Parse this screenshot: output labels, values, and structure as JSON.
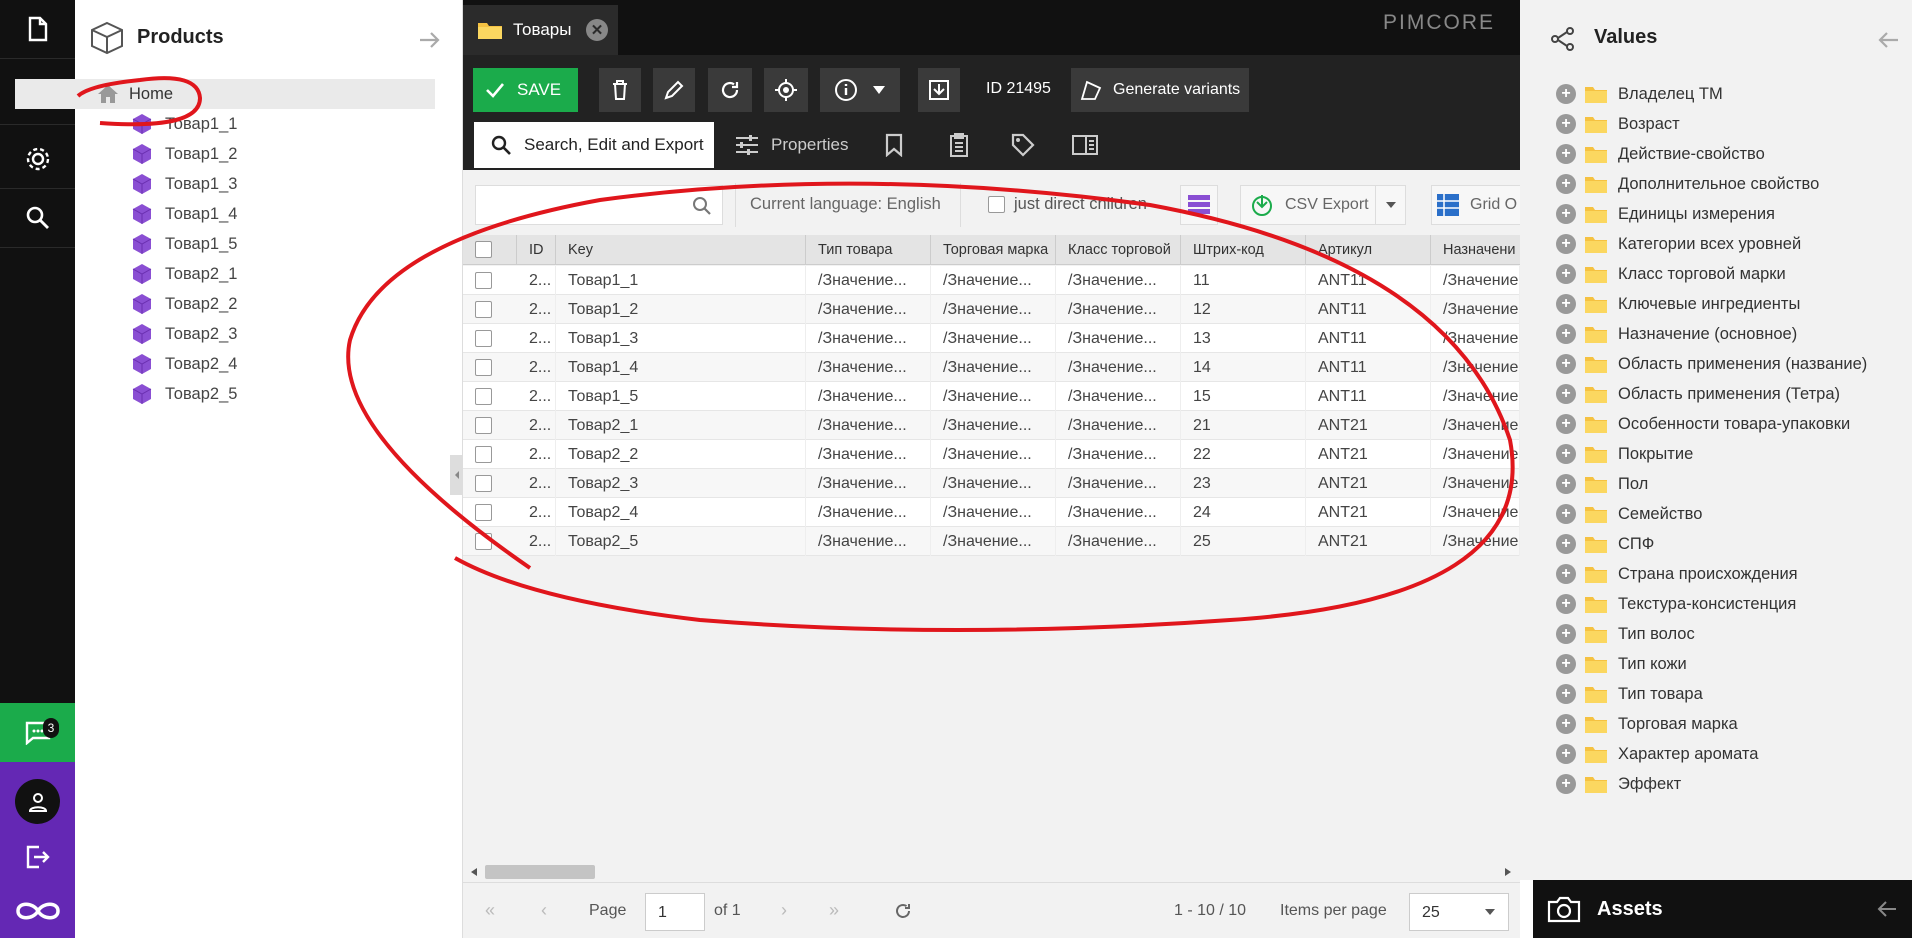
{
  "rail": {
    "chat_badge": "3"
  },
  "products": {
    "title": "Products",
    "home": "Home",
    "items": [
      "Товар1_1",
      "Товар1_2",
      "Товар1_3",
      "Товар1_4",
      "Товар1_5",
      "Товар2_1",
      "Товар2_2",
      "Товар2_3",
      "Товар2_4",
      "Товар2_5"
    ]
  },
  "header": {
    "tab_title": "Товары",
    "brand": "PIMCORE"
  },
  "toolbar": {
    "save_label": "SAVE",
    "id_label": "ID 21495",
    "generate_variants": "Generate variants"
  },
  "subtabs": {
    "search": "Search, Edit and Export",
    "properties": "Properties"
  },
  "filter": {
    "search_placeholder": "",
    "current_language": "Current language: English",
    "direct_children": "just direct children",
    "csv_export": "CSV Export",
    "grid_options": "Grid O"
  },
  "grid": {
    "columns": [
      "ID",
      "Key",
      "Тип товара",
      "Торговая марка",
      "Класс торговой",
      "Штрих-код",
      "Артикул",
      "Назначени"
    ],
    "rows": [
      {
        "id": "2...",
        "key": "Товар1_1",
        "type": "/Значение...",
        "brand": "/Значение...",
        "cls": "/Значение...",
        "barcode": "11",
        "sku": "ANT11",
        "purpose": "/Значение"
      },
      {
        "id": "2...",
        "key": "Товар1_2",
        "type": "/Значение...",
        "brand": "/Значение...",
        "cls": "/Значение...",
        "barcode": "12",
        "sku": "ANT11",
        "purpose": "/Значение"
      },
      {
        "id": "2...",
        "key": "Товар1_3",
        "type": "/Значение...",
        "brand": "/Значение...",
        "cls": "/Значение...",
        "barcode": "13",
        "sku": "ANT11",
        "purpose": "/Значение"
      },
      {
        "id": "2...",
        "key": "Товар1_4",
        "type": "/Значение...",
        "brand": "/Значение...",
        "cls": "/Значение...",
        "barcode": "14",
        "sku": "ANT11",
        "purpose": "/Значение"
      },
      {
        "id": "2...",
        "key": "Товар1_5",
        "type": "/Значение...",
        "brand": "/Значение...",
        "cls": "/Значение...",
        "barcode": "15",
        "sku": "ANT11",
        "purpose": "/Значение"
      },
      {
        "id": "2...",
        "key": "Товар2_1",
        "type": "/Значение...",
        "brand": "/Значение...",
        "cls": "/Значение...",
        "barcode": "21",
        "sku": "ANT21",
        "purpose": "/Значение"
      },
      {
        "id": "2...",
        "key": "Товар2_2",
        "type": "/Значение...",
        "brand": "/Значение...",
        "cls": "/Значение...",
        "barcode": "22",
        "sku": "ANT21",
        "purpose": "/Значение"
      },
      {
        "id": "2...",
        "key": "Товар2_3",
        "type": "/Значение...",
        "brand": "/Значение...",
        "cls": "/Значение...",
        "barcode": "23",
        "sku": "ANT21",
        "purpose": "/Значение"
      },
      {
        "id": "2...",
        "key": "Товар2_4",
        "type": "/Значение...",
        "brand": "/Значение...",
        "cls": "/Значение...",
        "barcode": "24",
        "sku": "ANT21",
        "purpose": "/Значение"
      },
      {
        "id": "2...",
        "key": "Товар2_5",
        "type": "/Значение...",
        "brand": "/Значение...",
        "cls": "/Значение...",
        "barcode": "25",
        "sku": "ANT21",
        "purpose": "/Значение"
      }
    ]
  },
  "pager": {
    "page_label": "Page",
    "page_value": "1",
    "of_label": "of 1",
    "range": "1 - 10 / 10",
    "items_per_page": "Items per page",
    "per_page_value": "25"
  },
  "values": {
    "title": "Values",
    "items": [
      "Владелец ТМ",
      "Возраст",
      "Действие-свойство",
      "Дополнительное свойство",
      "Единицы измерения",
      "Категории всех уровней",
      "Класс торговой марки",
      "Ключевые ингредиенты",
      "Назначение (основное)",
      "Область применения (название)",
      "Область применения (Тетра)",
      "Особенности товара-упаковки",
      "Покрытие",
      "Пол",
      "Семейство",
      "СПФ",
      "Страна происхождения",
      "Текстура-консистенция",
      "Тип волос",
      "Тип кожи",
      "Тип товара",
      "Торговая марка",
      "Характер аромата",
      "Эффект"
    ]
  },
  "assets": {
    "title": "Assets"
  },
  "colors": {
    "accent_green": "#1bab4b",
    "purple": "#6428b4",
    "annotation_red": "#e0161c"
  }
}
